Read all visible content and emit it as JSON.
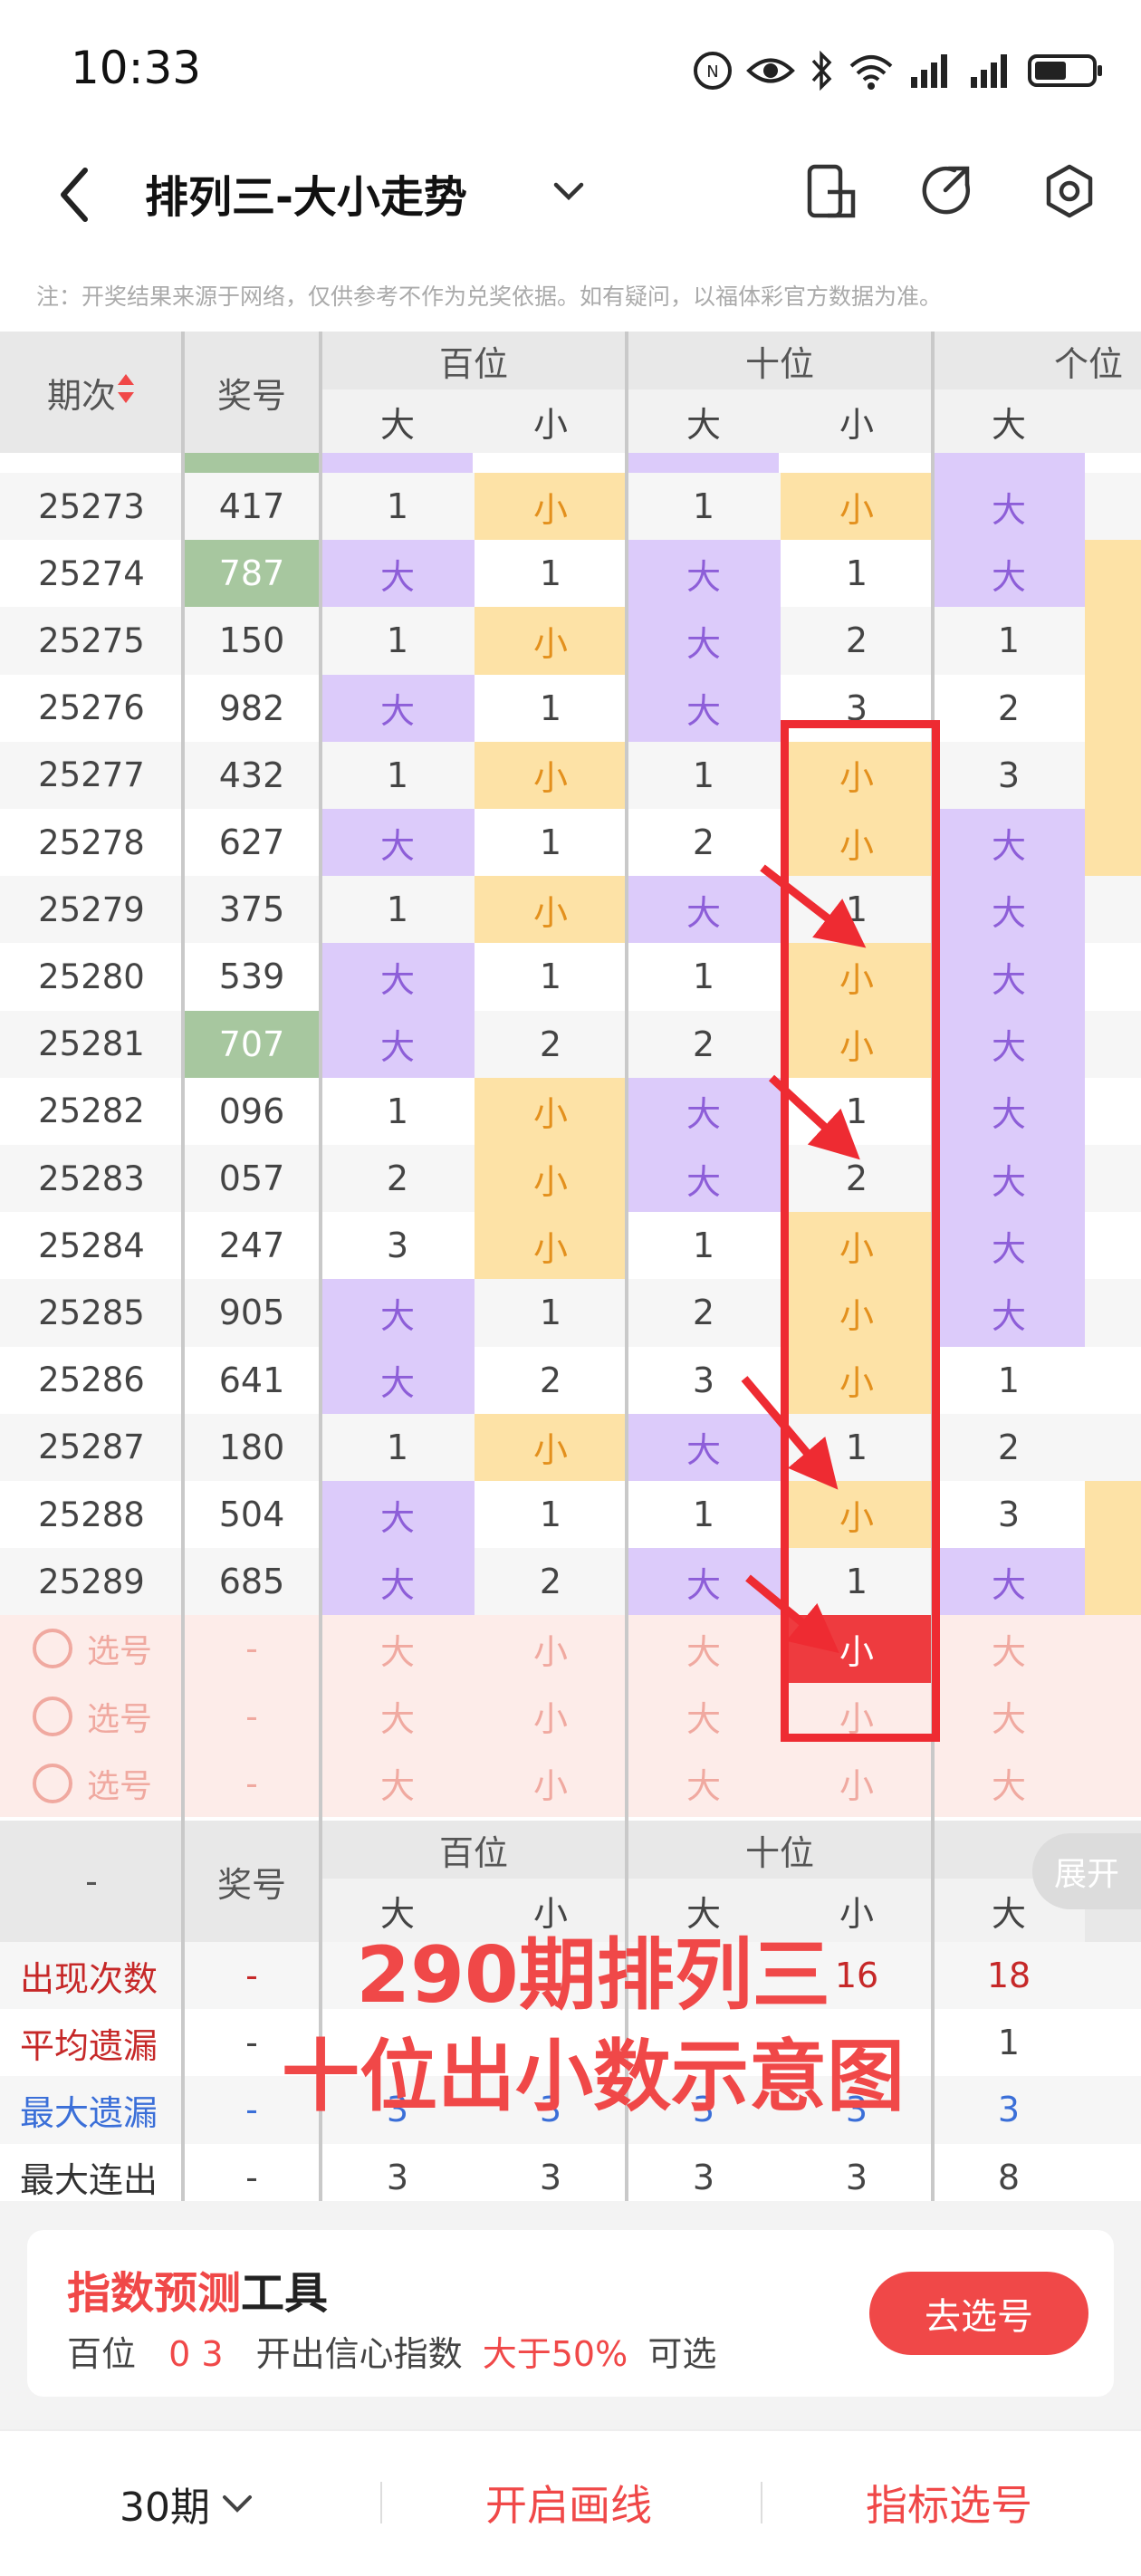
{
  "status": {
    "time": "10:33"
  },
  "header": {
    "title": "排列三-大小走势"
  },
  "notice": "注：开奖结果来源于网络，仅供参考不作为兑奖依据。如有疑问，以福体彩官方数据为准。",
  "table": {
    "col_issue": "期次",
    "col_number": "奖号",
    "groups": [
      "百位",
      "十位",
      "个位"
    ],
    "sub": [
      "大",
      "小"
    ],
    "rows": [
      {
        "issue": "25273",
        "num": "417",
        "c": [
          "1",
          "小",
          "1",
          "小",
          "大"
        ]
      },
      {
        "issue": "25274",
        "num": "787",
        "c": [
          "大",
          "1",
          "大",
          "1",
          "大"
        ]
      },
      {
        "issue": "25275",
        "num": "150",
        "c": [
          "1",
          "小",
          "大",
          "2",
          "1"
        ]
      },
      {
        "issue": "25276",
        "num": "982",
        "c": [
          "大",
          "1",
          "大",
          "3",
          "2"
        ]
      },
      {
        "issue": "25277",
        "num": "432",
        "c": [
          "1",
          "小",
          "1",
          "小",
          "3"
        ]
      },
      {
        "issue": "25278",
        "num": "627",
        "c": [
          "大",
          "1",
          "2",
          "小",
          "大"
        ]
      },
      {
        "issue": "25279",
        "num": "375",
        "c": [
          "1",
          "小",
          "大",
          "1",
          "大"
        ]
      },
      {
        "issue": "25280",
        "num": "539",
        "c": [
          "大",
          "1",
          "1",
          "小",
          "大"
        ]
      },
      {
        "issue": "25281",
        "num": "707",
        "c": [
          "大",
          "2",
          "2",
          "小",
          "大"
        ]
      },
      {
        "issue": "25282",
        "num": "096",
        "c": [
          "1",
          "小",
          "大",
          "1",
          "大"
        ]
      },
      {
        "issue": "25283",
        "num": "057",
        "c": [
          "2",
          "小",
          "大",
          "2",
          "大"
        ]
      },
      {
        "issue": "25284",
        "num": "247",
        "c": [
          "3",
          "小",
          "1",
          "小",
          "大"
        ]
      },
      {
        "issue": "25285",
        "num": "905",
        "c": [
          "大",
          "1",
          "2",
          "小",
          "大"
        ]
      },
      {
        "issue": "25286",
        "num": "641",
        "c": [
          "大",
          "2",
          "3",
          "小",
          "1"
        ]
      },
      {
        "issue": "25287",
        "num": "180",
        "c": [
          "1",
          "小",
          "大",
          "1",
          "2"
        ]
      },
      {
        "issue": "25288",
        "num": "504",
        "c": [
          "大",
          "1",
          "1",
          "小",
          "3"
        ]
      },
      {
        "issue": "25289",
        "num": "685",
        "c": [
          "大",
          "2",
          "大",
          "1",
          "大"
        ]
      }
    ],
    "pick_label": "选号",
    "dash": "-",
    "stats_labels": [
      "出现次数",
      "平均遗漏",
      "最大遗漏",
      "最大连出"
    ],
    "stats": [
      [
        "-",
        "",
        "",
        "",
        "16",
        "18"
      ],
      [
        "-",
        "",
        "",
        "",
        "",
        "1"
      ],
      [
        "-",
        "3",
        "3",
        "3",
        "3",
        "3"
      ],
      [
        "-",
        "3",
        "3",
        "3",
        "3",
        "8"
      ]
    ],
    "expand": "展开"
  },
  "overlay": {
    "line1": "290期排列三",
    "line2": "十位出小数示意图"
  },
  "tool": {
    "title_red": "指数预测",
    "title_black": "工具",
    "pos": "百位",
    "nums": "0 3",
    "desc": "开出信心指数",
    "cond": "大于50%",
    "tail": "可选",
    "button": "去选号"
  },
  "footer": {
    "period": "30期",
    "draw": "开启画线",
    "index": "指标选号"
  },
  "colors": {
    "big_bg": "#dccbfa",
    "small_bg": "#fde2a6",
    "accent": "#f04848",
    "highlight_num": "#a7c79f"
  }
}
